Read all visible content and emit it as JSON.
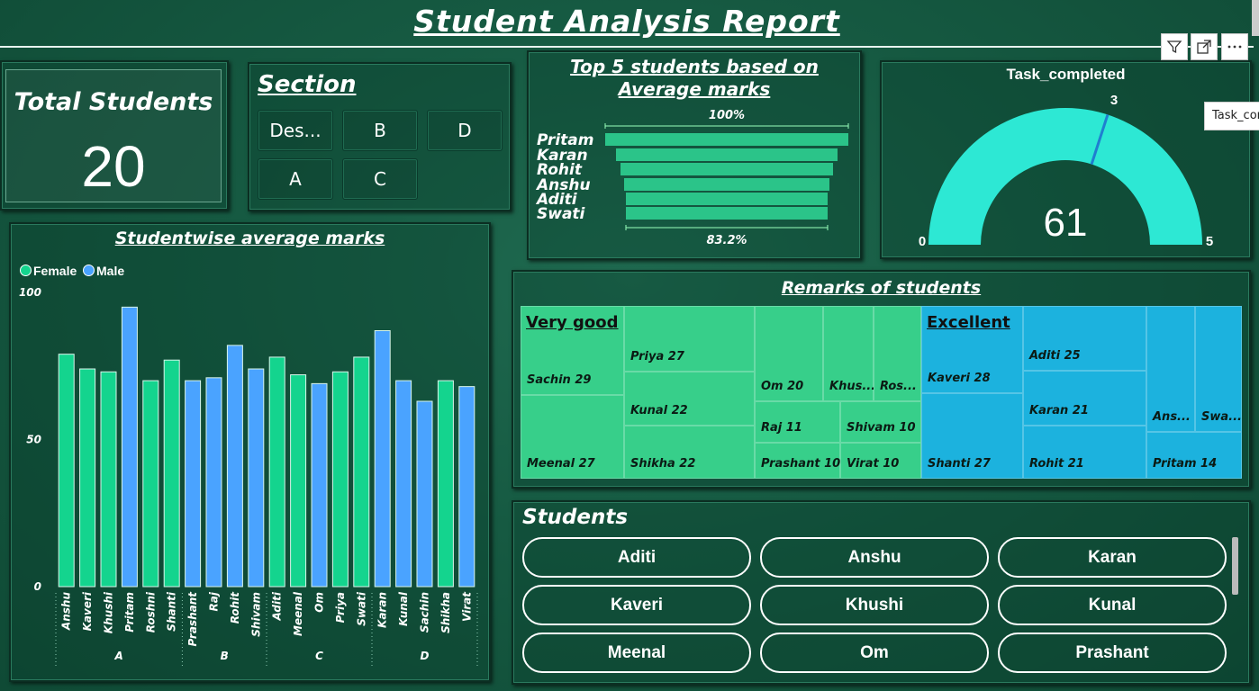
{
  "report": {
    "title": "Student Analysis Report"
  },
  "toolbar": {
    "filter_icon": "filter-icon",
    "focus_icon": "expand-icon",
    "more_icon": "more-options-icon"
  },
  "tooltip": {
    "text": "Task_com"
  },
  "total_students": {
    "label": "Total Students",
    "value": "20"
  },
  "section_slicer": {
    "title": "Section",
    "options": [
      "Des...",
      "B",
      "D",
      "A",
      "C"
    ]
  },
  "funnel": {
    "title": "Top 5 students based on Average marks",
    "top_pct": "100%",
    "bottom_pct": "83.2%",
    "names": [
      "Pritam",
      "Karan",
      "Rohit",
      "Anshu",
      "Aditi",
      "Swati"
    ]
  },
  "gauge": {
    "title": "Task_completed",
    "value": "61",
    "min": "0",
    "max": "5",
    "target": "3",
    "fill_fraction": 1.0,
    "target_fraction": 0.6,
    "colors": {
      "fill": "#2de8d4",
      "target": "#1f7fd0"
    }
  },
  "bar_chart": {
    "title": "Studentwise average marks",
    "legend": {
      "female": "Female",
      "male": "Male"
    },
    "colors": {
      "female": "#14d48e",
      "male": "#4aa3ff"
    }
  },
  "chart_data": {
    "type": "bar",
    "title": "Studentwise average marks",
    "ylim": [
      0,
      100
    ],
    "yticks": [
      "0",
      "50",
      "100"
    ],
    "series_legend": [
      "Female",
      "Male"
    ],
    "groups": [
      {
        "label": "A",
        "students": [
          "Anshu",
          "Kaveri",
          "Khushi",
          "Pritam",
          "Roshni",
          "Shanti"
        ]
      },
      {
        "label": "B",
        "students": [
          "Prashant",
          "Raj",
          "Rohit",
          "Shivam"
        ]
      },
      {
        "label": "C",
        "students": [
          "Aditi",
          "Meenal",
          "Om",
          "Priya",
          "Swati"
        ]
      },
      {
        "label": "D",
        "students": [
          "Karan",
          "Kunal",
          "Sachin",
          "Shikha",
          "Virat"
        ]
      }
    ],
    "categories": [
      "Anshu",
      "Kaveri",
      "Khushi",
      "Pritam",
      "Roshni",
      "Shanti",
      "Prashant",
      "Raj",
      "Rohit",
      "Shivam",
      "Aditi",
      "Meenal",
      "Om",
      "Priya",
      "Swati",
      "Karan",
      "Kunal",
      "Sachin",
      "Shikha",
      "Virat"
    ],
    "values": [
      79,
      74,
      73,
      95,
      70,
      77,
      70,
      71,
      82,
      74,
      78,
      72,
      69,
      73,
      78,
      87,
      70,
      63,
      70,
      68
    ],
    "gender": [
      "Female",
      "Female",
      "Female",
      "Male",
      "Female",
      "Female",
      "Male",
      "Male",
      "Male",
      "Male",
      "Female",
      "Female",
      "Male",
      "Female",
      "Female",
      "Male",
      "Male",
      "Male",
      "Female",
      "Male"
    ]
  },
  "remarks": {
    "title": "Remarks of students",
    "very_good": {
      "label": "Very good",
      "items": [
        "Sachin 29",
        "Meenal 27",
        "Priya 27",
        "Kunal 22",
        "Shikha 22",
        "Om 20",
        "Khus...",
        "Ros...",
        "Raj 11",
        "Shivam 10",
        "Prashant 10",
        "Virat 10"
      ]
    },
    "excellent": {
      "label": "Excellent",
      "items": [
        "Kaveri 28",
        "Shanti 27",
        "Aditi 25",
        "Karan 21",
        "Rohit 21",
        "Ans...",
        "Swa...",
        "Pritam 14"
      ]
    }
  },
  "students_slicer": {
    "title": "Students",
    "options": [
      "Aditi",
      "Anshu",
      "Karan",
      "Kaveri",
      "Khushi",
      "Kunal",
      "Meenal",
      "Om",
      "Prashant"
    ]
  }
}
